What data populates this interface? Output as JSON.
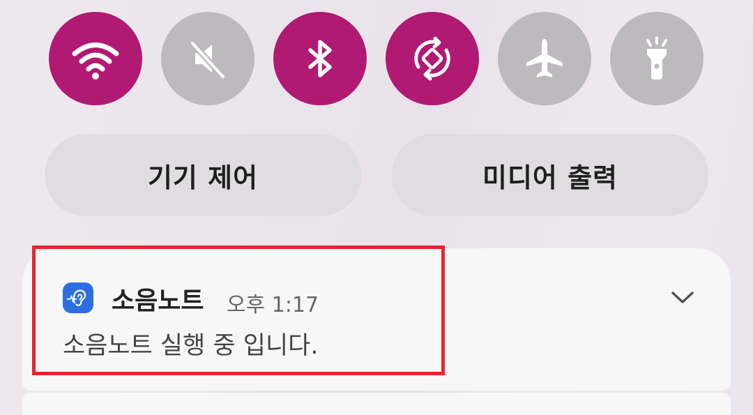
{
  "quick_toggles": [
    {
      "name": "wifi",
      "icon": "wifi-icon",
      "state": "on"
    },
    {
      "name": "sound",
      "icon": "mute-icon",
      "state": "off"
    },
    {
      "name": "bluetooth",
      "icon": "bluetooth-icon",
      "state": "on"
    },
    {
      "name": "auto-rotate",
      "icon": "rotate-icon",
      "state": "on"
    },
    {
      "name": "airplane",
      "icon": "airplane-icon",
      "state": "off"
    },
    {
      "name": "flashlight",
      "icon": "flashlight-icon",
      "state": "off"
    }
  ],
  "controls": {
    "device_control_label": "기기 제어",
    "media_output_label": "미디어 출력"
  },
  "notification": {
    "app_name": "소음노트",
    "time": "오후 1:17",
    "message": "소음노트 실행 중 입니다."
  },
  "colors": {
    "accent": "#b01a72",
    "toggle_off": "#bdbabd",
    "app_icon": "#2d6fe0",
    "highlight": "#e5262f"
  }
}
